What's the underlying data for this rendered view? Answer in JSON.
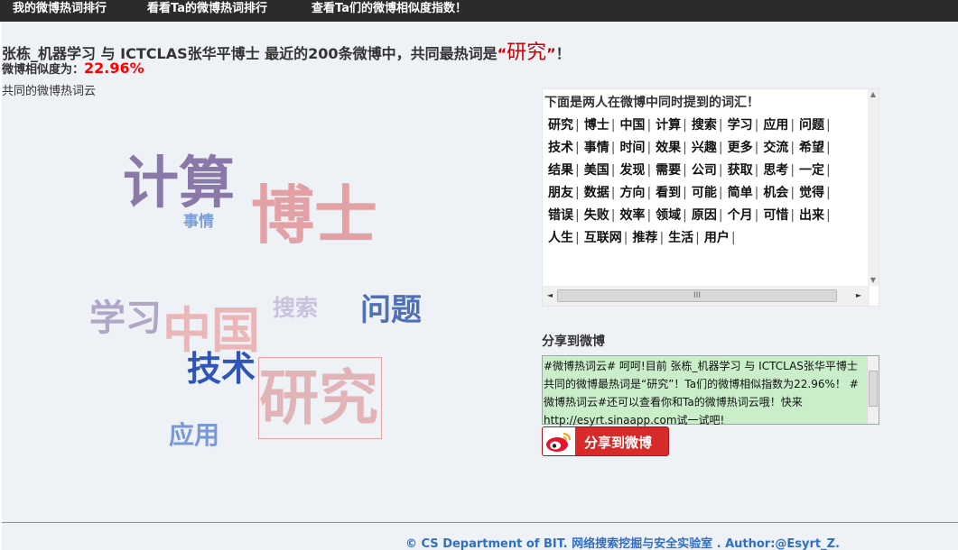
{
  "nav": {
    "items": [
      "我的微博热词排行",
      "看看Ta的微博热词排行",
      "查看Ta们的微博相似度指数！"
    ]
  },
  "headline": {
    "prefix": "张栋_机器学习  与  ICTCLAS张华平博士  最近的200条微博中，共同最热词是",
    "quote_open": "“",
    "word": "研究",
    "quote_close": "”",
    "suffix": "！"
  },
  "similarity": {
    "label": "微博相似度为：",
    "value": "22.96%"
  },
  "cloud": {
    "title": "共同的微博热词云",
    "words": [
      {
        "text": "计算",
        "color": "#8a79a8"
      },
      {
        "text": "博士",
        "color": "#e3a1a5"
      },
      {
        "text": "事情",
        "color": "#7b9fd3"
      },
      {
        "text": "学习",
        "color": "#b0a7c7"
      },
      {
        "text": "中国",
        "color": "#ebb6b8"
      },
      {
        "text": "搜索",
        "color": "#c9c3dc"
      },
      {
        "text": "问题",
        "color": "#4f6fb8"
      },
      {
        "text": "技术",
        "color": "#2f55b8"
      },
      {
        "text": "研究",
        "color": "#e3b4b7"
      },
      {
        "text": "应用",
        "color": "#7b98d6"
      }
    ]
  },
  "shared_panel": {
    "title": "下面是两人在微博中同时提到的词汇！",
    "rows": [
      [
        "研究",
        "博士",
        "中国",
        "计算",
        "搜索",
        "学习",
        "应用",
        "问题"
      ],
      [
        "技术",
        "事情",
        "时间",
        "效果",
        "兴趣",
        "更多",
        "交流",
        "希望"
      ],
      [
        "结果",
        "美国",
        "发现",
        "需要",
        "公司",
        "获取",
        "思考",
        "一定"
      ],
      [
        "朋友",
        "数据",
        "方向",
        "看到",
        "可能",
        "简单",
        "机会",
        "觉得"
      ],
      [
        "错误",
        "失败",
        "效率",
        "领域",
        "原因",
        "个月",
        "可惜",
        "出来"
      ],
      [
        "人生",
        "互联网",
        "推荐",
        "生活",
        "用户"
      ]
    ],
    "separator": "|",
    "scroll_thumb": "III",
    "scroll_up": "▲",
    "scroll_down": "▼",
    "scroll_left": "◄",
    "scroll_right": "►"
  },
  "share": {
    "label": "分享到微博",
    "text": "#微博热词云# 呵呵!目前 张栋_机器学习 与 ICTCLAS张华平博士共同的微博最热词是“研究”！Ta们的微博相似指数为22.96%！ #微博热词云#还可以查看你和Ta的微博热词云哦！快来http://esyrt.sinaapp.com试一试吧!",
    "button": "分享到微博"
  },
  "footer": {
    "text": "© CS Department of BIT. 网络搜索挖掘与安全实验室  . Author:@Esyrt_Z."
  }
}
